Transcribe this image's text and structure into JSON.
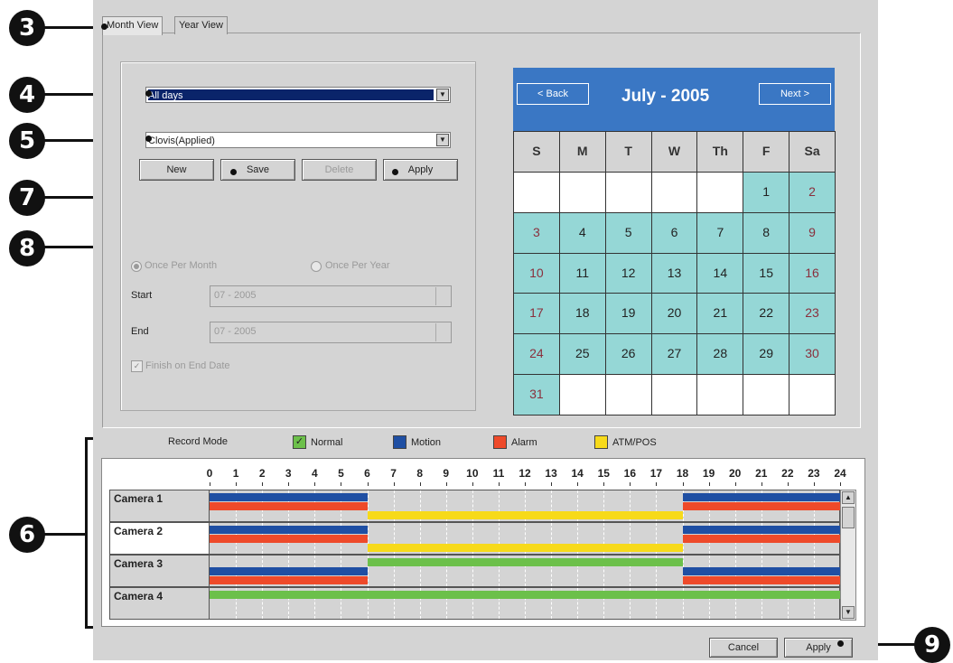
{
  "tabs": [
    "Month View",
    "Year View"
  ],
  "schedule_combo": {
    "value": "All days"
  },
  "site_combo": {
    "value": "Clovis(Applied)"
  },
  "buttons": {
    "new": "New",
    "save": "Save",
    "delete": "Delete",
    "apply": "Apply",
    "cancel": "Cancel",
    "bottom_apply": "Apply"
  },
  "repeat": {
    "once_per_month": "Once Per Month",
    "once_per_year": "Once Per Year",
    "selected": "Once Per Month"
  },
  "start": {
    "label": "Start",
    "value": "07 - 2005"
  },
  "end": {
    "label": "End",
    "value": "07 - 2005"
  },
  "finish_on_end": {
    "label": "Finish on End Date",
    "checked": true
  },
  "calendar": {
    "back": "< Back",
    "next": "Next >",
    "title": "July - 2005",
    "weekdays": [
      "S",
      "M",
      "T",
      "W",
      "Th",
      "F",
      "Sa"
    ],
    "weeks": [
      [
        "",
        "",
        "",
        "",
        "",
        "1",
        "2"
      ],
      [
        "3",
        "4",
        "5",
        "6",
        "7",
        "8",
        "9"
      ],
      [
        "10",
        "11",
        "12",
        "13",
        "14",
        "15",
        "16"
      ],
      [
        "17",
        "18",
        "19",
        "20",
        "21",
        "22",
        "23"
      ],
      [
        "24",
        "25",
        "26",
        "27",
        "28",
        "29",
        "30"
      ],
      [
        "31",
        "",
        "",
        "",
        "",
        "",
        ""
      ]
    ],
    "header_color": "#3a77c4",
    "day_color": "#95d7d6"
  },
  "record_mode": {
    "label": "Record Mode",
    "items": [
      {
        "label": "Normal",
        "color": "#6cc04a",
        "checked": true
      },
      {
        "label": "Motion",
        "color": "#1f4fa3"
      },
      {
        "label": "Alarm",
        "color": "#ee4a2a"
      },
      {
        "label": "ATM/POS",
        "color": "#f7da1a"
      }
    ]
  },
  "hours": [
    "0",
    "1",
    "2",
    "3",
    "4",
    "5",
    "6",
    "7",
    "8",
    "9",
    "10",
    "11",
    "12",
    "13",
    "14",
    "15",
    "16",
    "17",
    "18",
    "19",
    "20",
    "21",
    "22",
    "23",
    "24"
  ],
  "cameras": [
    {
      "name": "Camera 1",
      "bars": [
        {
          "mode": "Motion",
          "start": 0,
          "end": 6,
          "lane": 0
        },
        {
          "mode": "Alarm",
          "start": 0,
          "end": 6,
          "lane": 1
        },
        {
          "mode": "ATM/POS",
          "start": 6,
          "end": 18,
          "lane": 2
        },
        {
          "mode": "Motion",
          "start": 18,
          "end": 24,
          "lane": 0
        },
        {
          "mode": "Alarm",
          "start": 18,
          "end": 24,
          "lane": 1
        }
      ]
    },
    {
      "name": "Camera 2",
      "bars": [
        {
          "mode": "Motion",
          "start": 0,
          "end": 6,
          "lane": 0
        },
        {
          "mode": "Alarm",
          "start": 0,
          "end": 6,
          "lane": 1
        },
        {
          "mode": "ATM/POS",
          "start": 6,
          "end": 18,
          "lane": 2
        },
        {
          "mode": "Motion",
          "start": 18,
          "end": 24,
          "lane": 0
        },
        {
          "mode": "Alarm",
          "start": 18,
          "end": 24,
          "lane": 1
        }
      ]
    },
    {
      "name": "Camera 3",
      "bars": [
        {
          "mode": "Normal",
          "start": 6,
          "end": 18,
          "lane": 0
        },
        {
          "mode": "Motion",
          "start": 0,
          "end": 6,
          "lane": 1
        },
        {
          "mode": "Alarm",
          "start": 0,
          "end": 6,
          "lane": 2
        },
        {
          "mode": "Motion",
          "start": 18,
          "end": 24,
          "lane": 1
        },
        {
          "mode": "Alarm",
          "start": 18,
          "end": 24,
          "lane": 2
        }
      ]
    },
    {
      "name": "Camera 4",
      "bars": [
        {
          "mode": "Normal",
          "start": 0,
          "end": 24,
          "lane": 0
        }
      ]
    }
  ],
  "callouts": [
    "3",
    "4",
    "5",
    "6",
    "7",
    "8",
    "9"
  ]
}
